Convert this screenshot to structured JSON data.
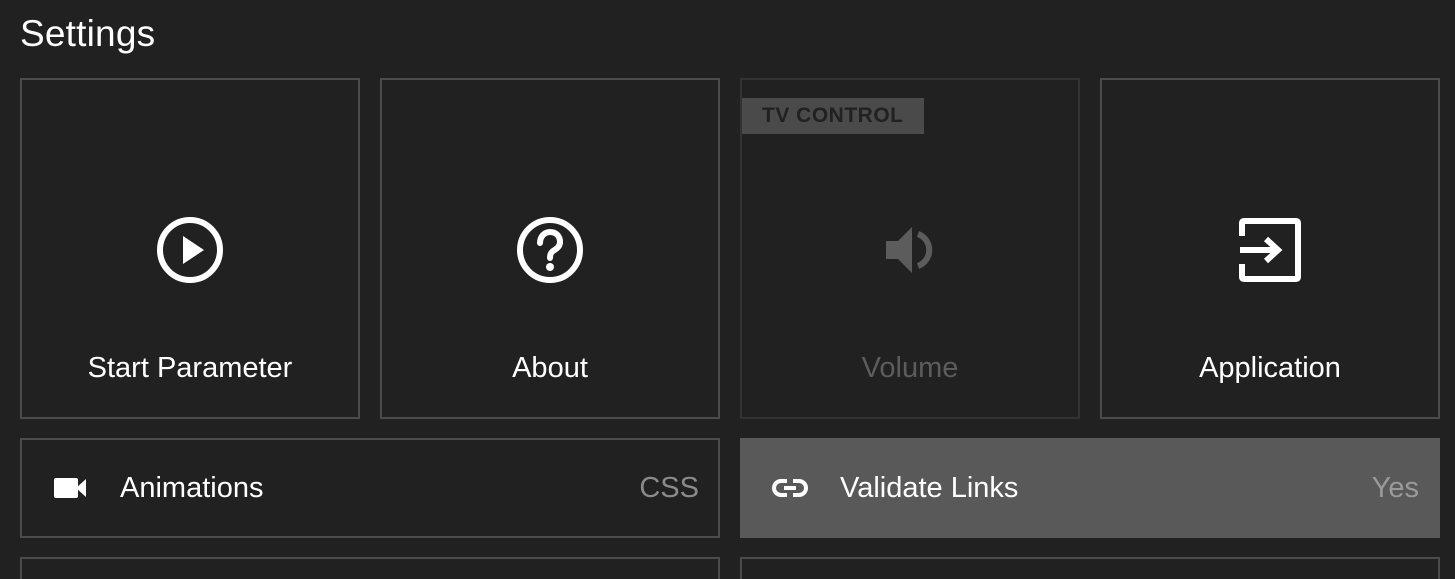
{
  "page": {
    "title": "Settings"
  },
  "tiles": [
    {
      "label": "Start Parameter",
      "icon": "play-circle-icon",
      "enabled": true
    },
    {
      "label": "About",
      "icon": "help-circle-icon",
      "enabled": true
    },
    {
      "label": "Volume",
      "icon": "volume-icon",
      "enabled": false,
      "tag": "TV CONTROL"
    },
    {
      "label": "Application",
      "icon": "exit-to-app-icon",
      "enabled": true
    }
  ],
  "rows": [
    {
      "label": "Animations",
      "value": "CSS",
      "icon": "videocam-icon",
      "focused": false
    },
    {
      "label": "Validate Links",
      "value": "Yes",
      "icon": "link-icon",
      "focused": true
    }
  ],
  "colors": {
    "background": "#212121",
    "border": "#4b4b4b",
    "focused": "#595959",
    "disabled_text": "#5c5c5c",
    "value_text": "#8a8a8a"
  }
}
